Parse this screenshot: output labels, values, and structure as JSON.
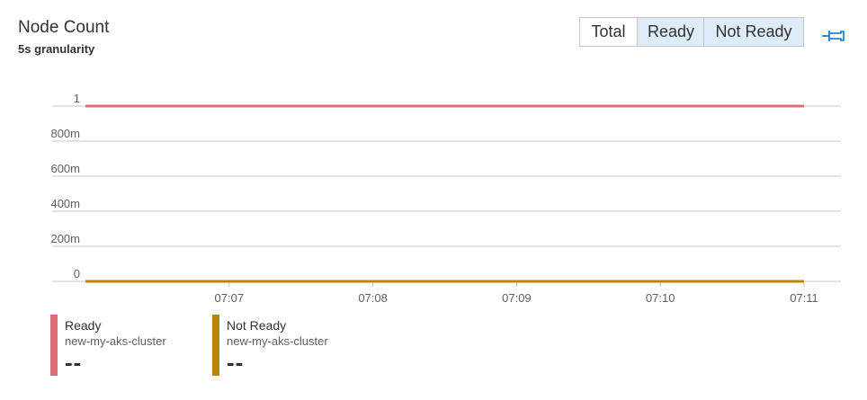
{
  "header": {
    "title": "Node Count",
    "granularity": "5s granularity"
  },
  "toggles": [
    {
      "label": "Total",
      "active": false
    },
    {
      "label": "Ready",
      "active": true
    },
    {
      "label": "Not Ready",
      "active": true
    }
  ],
  "pin_icon": "pin-icon",
  "colors": {
    "ready": "#e06c75",
    "not_ready": "#b8860b",
    "grid": "#c8c6c4",
    "axis_text": "#605e5c",
    "toggle_active_bg": "#deecf9",
    "pin": "#0078d4"
  },
  "chart_data": {
    "type": "line",
    "y_ticks": [
      "1",
      "800m",
      "600m",
      "400m",
      "200m",
      "0"
    ],
    "y_tick_values": [
      1,
      0.8,
      0.6,
      0.4,
      0.2,
      0
    ],
    "ylim": [
      0,
      1
    ],
    "x_ticks": [
      "07:07",
      "07:08",
      "07:09",
      "07:10",
      "07:11"
    ],
    "x_range": [
      "07:06:00",
      "07:11:00"
    ],
    "grid": true,
    "series": [
      {
        "name": "Ready",
        "color": "#e06c75",
        "x": [
          "07:06:00",
          "07:11:00"
        ],
        "values": [
          1,
          1
        ]
      },
      {
        "name": "Not Ready",
        "color": "#b8860b",
        "x": [
          "07:06:00",
          "07:11:00"
        ],
        "values": [
          0,
          0
        ]
      }
    ]
  },
  "legend": [
    {
      "name": "Ready",
      "resource": "new-my-aks-cluster",
      "value": "--"
    },
    {
      "name": "Not Ready",
      "resource": "new-my-aks-cluster",
      "value": "--"
    }
  ]
}
